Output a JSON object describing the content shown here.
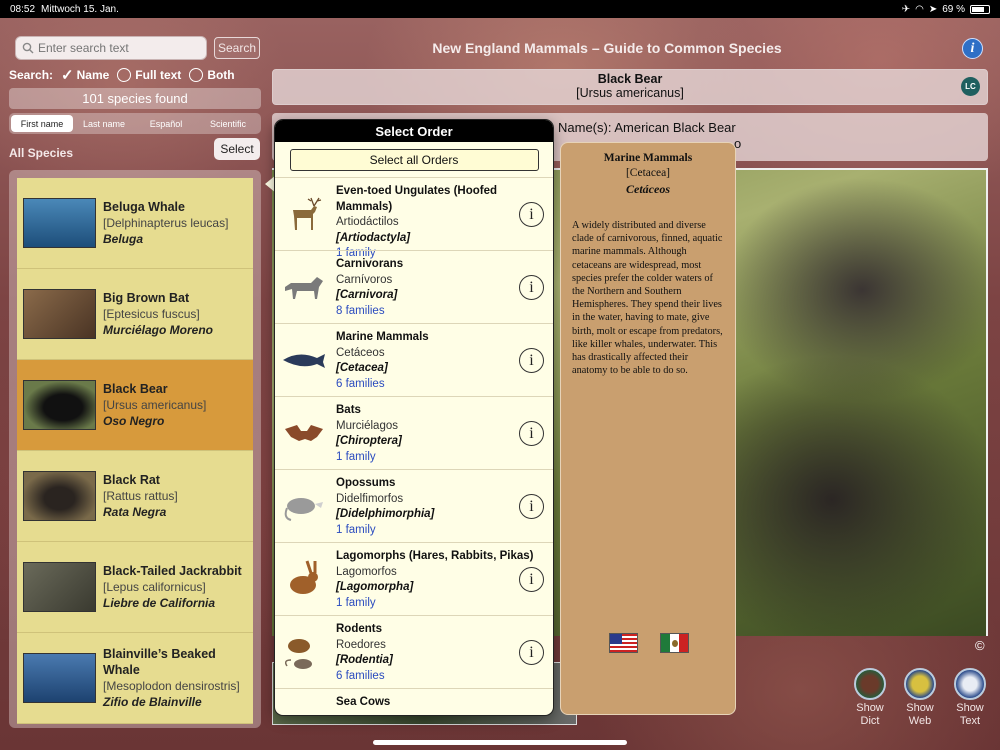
{
  "status": {
    "time": "08:52",
    "date": "Mittwoch 15. Jan.",
    "battery": "69 %"
  },
  "search": {
    "placeholder": "Enter search text",
    "button": "Search",
    "label": "Search:",
    "options": [
      "Name",
      "Full text",
      "Both"
    ],
    "selected": "Name"
  },
  "results_count": "101 species found",
  "sort_tabs": [
    "First name",
    "Last name",
    "Español",
    "Scientific"
  ],
  "sort_active": "First name",
  "list_title": "All Species",
  "select_button": "Select",
  "species": [
    {
      "name": "Beluga Whale",
      "latin": "[Delphinapterus leucas]",
      "spanish": "Beluga"
    },
    {
      "name": "Big Brown Bat",
      "latin": "[Eptesicus fuscus]",
      "spanish": "Murciélago Moreno"
    },
    {
      "name": "Black Bear",
      "latin": "[Ursus americanus]",
      "spanish": "Oso Negro",
      "selected": true
    },
    {
      "name": "Black Rat",
      "latin": "[Rattus rattus]",
      "spanish": "Rata Negra"
    },
    {
      "name": "Black-Tailed Jackrabbit",
      "latin": "[Lepus californicus]",
      "spanish": "Liebre de California"
    },
    {
      "name": "Blainville’s Beaked Whale",
      "latin": "[Mesoplodon densirostris]",
      "spanish": "Zifio de Blainville"
    }
  ],
  "app_title": "New England Mammals – Guide to Common Species",
  "header": {
    "name": "Black Bear",
    "latin": "[Ursus americanus]",
    "status_badge": "LC"
  },
  "names_line": {
    "label": "Name(s):",
    "value": "American Black Bear",
    "second_partial": "o"
  },
  "popover": {
    "title": "Select Order",
    "select_all": "Select all Orders",
    "orders": [
      {
        "name": "Even-toed Ungulates (Hoofed Mammals)",
        "spanish": "Artiodáctilos",
        "latin": "[Artiodactyla]",
        "families": "1 family"
      },
      {
        "name": "Carnivorans",
        "spanish": "Carnívoros",
        "latin": "[Carnivora]",
        "families": "8 families"
      },
      {
        "name": "Marine Mammals",
        "spanish": "Cetáceos",
        "latin": "[Cetacea]",
        "families": "6 families"
      },
      {
        "name": "Bats",
        "spanish": "Murciélagos",
        "latin": "[Chiroptera]",
        "families": "1 family"
      },
      {
        "name": "Opossums",
        "spanish": "Didelfimorfos",
        "latin": "[Didelphimorphia]",
        "families": "1 family"
      },
      {
        "name": "Lagomorphs (Hares, Rabbits, Pikas)",
        "spanish": "Lagomorfos",
        "latin": "[Lagomorpha]",
        "families": "1 family"
      },
      {
        "name": "Rodents",
        "spanish": "Roedores",
        "latin": "[Rodentia]",
        "families": "6 families"
      },
      {
        "name": "Sea Cows",
        "spanish": "",
        "latin": "",
        "families": ""
      }
    ]
  },
  "detail": {
    "title": "Marine Mammals",
    "latin": "[Cetacea]",
    "spanish": "Cetáceos",
    "description": "A widely distributed and diverse clade of carnivorous, finned, aquatic marine mammals. Although cetaceans are widespread, most species prefer the colder waters of the Northern and Southern Hemispheres. They spend their lives in the water, having to mate, give birth, molt or escape from predators, like killer whales, underwater. This has drastically affected their anatomy to be able to do so."
  },
  "copyright_symbol": "©",
  "tools": [
    {
      "line1": "Show",
      "line2": "Dict"
    },
    {
      "line1": "Show",
      "line2": "Web"
    },
    {
      "line1": "Show",
      "line2": "Text"
    }
  ],
  "icons": {
    "info": "i",
    "order_info": "i",
    "check": "✓"
  },
  "colors": {
    "list_item": "#e6dc90",
    "list_selected": "#d79a3c",
    "popover_bg": "#fffee6",
    "detail_bg": "#c99f6f",
    "family_link": "#2a4bbf"
  }
}
